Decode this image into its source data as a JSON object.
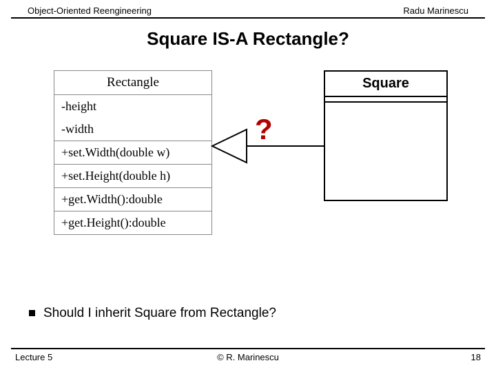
{
  "header": {
    "left": "Object-Oriented Reengineering",
    "right": "Radu Marinescu"
  },
  "title": "Square IS-A Rectangle?",
  "uml_rectangle": {
    "name": "Rectangle",
    "attributes": [
      "-height",
      "-width"
    ],
    "methods": [
      "+set.Width(double w)",
      "+set.Height(double h)",
      "+get.Width():double",
      "+get.Height():double"
    ]
  },
  "uml_square": {
    "name": "Square"
  },
  "arrow_label": "?",
  "bullet": "Should I inherit Square from Rectangle?",
  "footer": {
    "left": "Lecture 5",
    "center": "© R. Marinescu",
    "right": "18"
  }
}
